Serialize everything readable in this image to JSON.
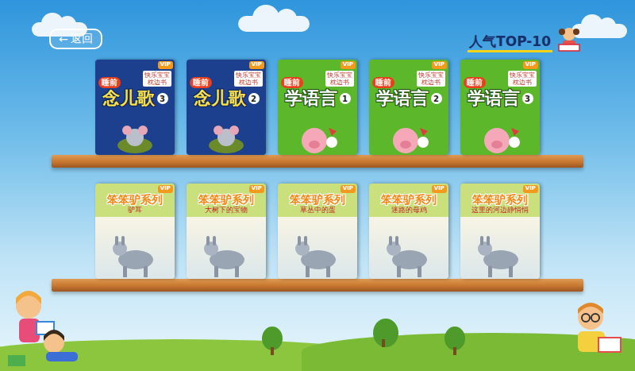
{
  "back_button": {
    "icon": "←",
    "label": "返回"
  },
  "header": {
    "title": "人气TOP-10"
  },
  "shelves": [
    {
      "books": [
        {
          "kind": "rhyme",
          "badge": "睡前",
          "title": "念儿歌",
          "number": "3",
          "tag": "快乐宝宝枕边书",
          "vip": "VIP",
          "color": "#1c3f8e"
        },
        {
          "kind": "rhyme",
          "badge": "睡前",
          "title": "念儿歌",
          "number": "2",
          "tag": "快乐宝宝枕边书",
          "vip": "VIP",
          "color": "#1c3f8e"
        },
        {
          "kind": "language",
          "badge": "睡前",
          "title": "学语言",
          "number": "1",
          "tag": "快乐宝宝枕边书",
          "vip": "VIP",
          "color": "#5cb82a"
        },
        {
          "kind": "language",
          "badge": "睡前",
          "title": "学语言",
          "number": "2",
          "tag": "快乐宝宝枕边书",
          "vip": "VIP",
          "color": "#5cb82a"
        },
        {
          "kind": "language",
          "badge": "睡前",
          "title": "学语言",
          "number": "3",
          "tag": "快乐宝宝枕边书",
          "vip": "VIP",
          "color": "#5cb82a"
        }
      ]
    },
    {
      "books": [
        {
          "kind": "series",
          "series": "笨笨驴系列",
          "title": "驴耳",
          "vip": "VIP",
          "color": "#c9e07c"
        },
        {
          "kind": "series",
          "series": "笨笨驴系列",
          "title": "大树下的宝物",
          "vip": "VIP",
          "color": "#c9e07c"
        },
        {
          "kind": "series",
          "series": "笨笨驴系列",
          "title": "草丛中的蛋",
          "vip": "VIP",
          "color": "#c9e07c"
        },
        {
          "kind": "series",
          "series": "笨笨驴系列",
          "title": "迷路的母鸡",
          "vip": "VIP",
          "color": "#c9e07c"
        },
        {
          "kind": "series",
          "series": "笨笨驴系列",
          "title": "这里的河边静悄悄",
          "vip": "VIP",
          "color": "#c9e07c"
        }
      ]
    }
  ]
}
